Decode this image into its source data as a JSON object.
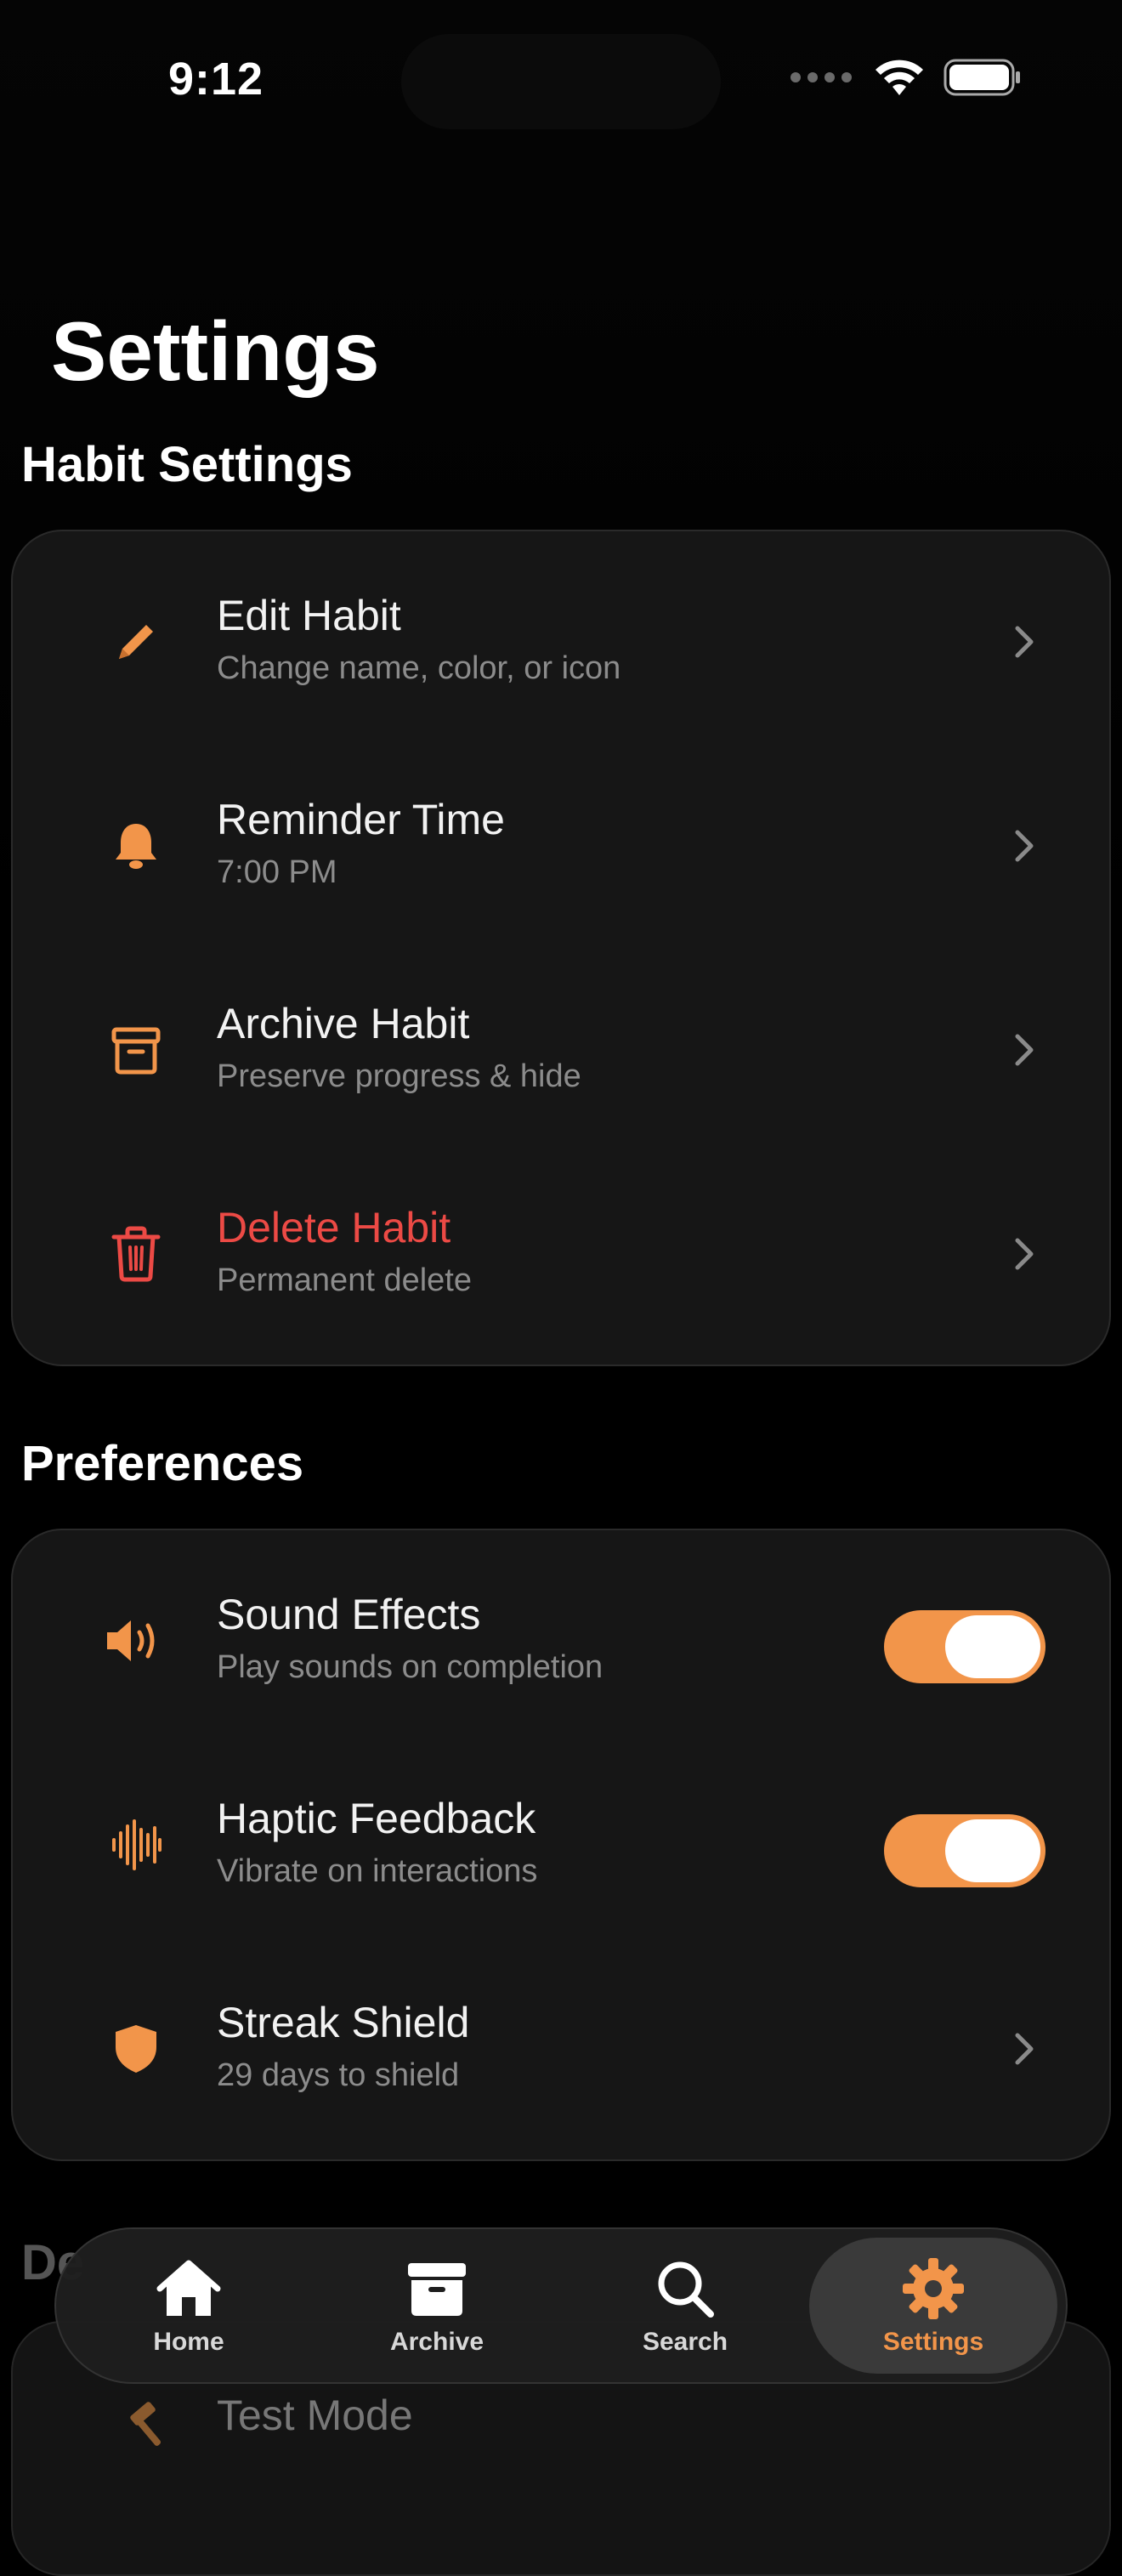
{
  "status_bar": {
    "time": "9:12"
  },
  "page": {
    "title": "Settings"
  },
  "colors": {
    "accent": "#F2954A",
    "danger": "#EC4A45",
    "background": "#000000",
    "card": "#161616",
    "secondary_text": "#8C8C8C"
  },
  "habit_settings": {
    "header": "Habit Settings",
    "items": [
      {
        "icon": "pencil-icon",
        "title": "Edit Habit",
        "subtitle": "Change name, color, or icon",
        "accessory": "chevron"
      },
      {
        "icon": "bell-icon",
        "title": "Reminder Time",
        "subtitle": "7:00 PM",
        "accessory": "chevron"
      },
      {
        "icon": "archive-box-icon",
        "title": "Archive Habit",
        "subtitle": "Preserve progress & hide",
        "accessory": "chevron"
      },
      {
        "icon": "trash-icon",
        "title": "Delete Habit",
        "subtitle": "Permanent delete",
        "accessory": "chevron",
        "destructive": true
      }
    ]
  },
  "preferences": {
    "header": "Preferences",
    "items": [
      {
        "icon": "speaker-icon",
        "title": "Sound Effects",
        "subtitle": "Play sounds on completion",
        "accessory": "toggle",
        "enabled": true
      },
      {
        "icon": "waveform-icon",
        "title": "Haptic Feedback",
        "subtitle": "Vibrate on interactions",
        "accessory": "toggle",
        "enabled": true
      },
      {
        "icon": "shield-icon",
        "title": "Streak Shield",
        "subtitle": "29 days to shield",
        "accessory": "chevron"
      }
    ]
  },
  "developer": {
    "header": "De",
    "items": [
      {
        "icon": "hammer-icon",
        "title": "Test Mode"
      }
    ]
  },
  "tab_bar": {
    "tabs": [
      {
        "icon": "house-icon",
        "label": "Home",
        "active": false
      },
      {
        "icon": "archive-box-icon",
        "label": "Archive",
        "active": false
      },
      {
        "icon": "magnifying-glass-icon",
        "label": "Search",
        "active": false
      },
      {
        "icon": "gear-icon",
        "label": "Settings",
        "active": true
      }
    ]
  }
}
